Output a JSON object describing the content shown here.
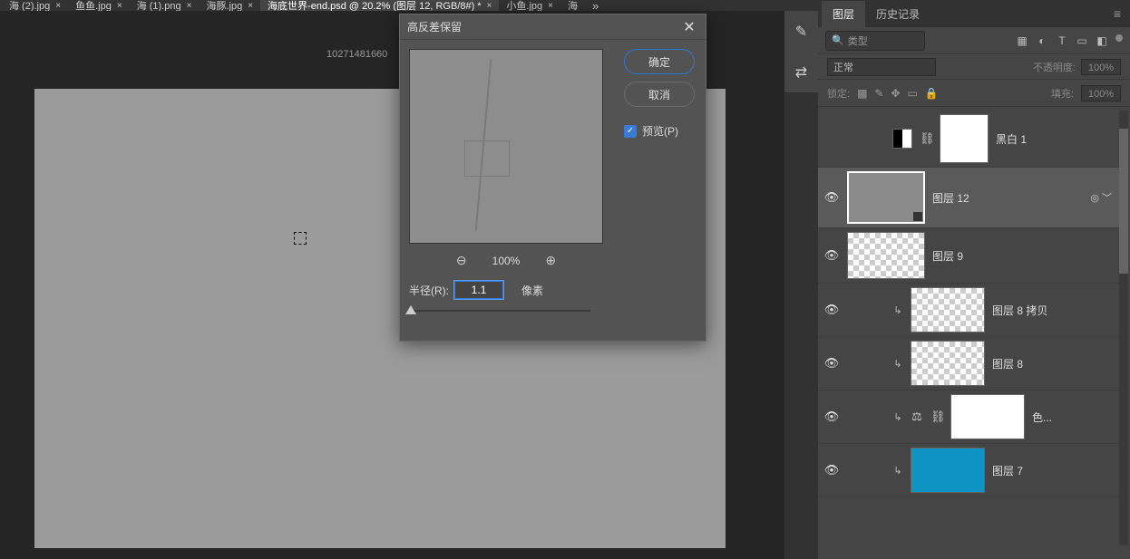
{
  "tabs": [
    {
      "label": "海 (2).jpg"
    },
    {
      "label": "鱼鱼.jpg"
    },
    {
      "label": "海 (1).png"
    },
    {
      "label": "海豚.jpg"
    },
    {
      "label": "海底世界-end.psd @ 20.2% (图层 12, RGB/8#) *"
    },
    {
      "label": "小鱼.jpg"
    },
    {
      "label": "海"
    }
  ],
  "tab_overflow": "»",
  "canvas_info": "10271481660",
  "dialog": {
    "title": "高反差保留",
    "ok": "确定",
    "cancel": "取消",
    "preview_label": "预览(P)",
    "zoom_pct": "100%",
    "radius_label": "半径(R):",
    "radius_value": "1.1",
    "radius_unit": "像素"
  },
  "panel_tabs": {
    "layers": "图层",
    "history": "历史记录"
  },
  "filter_placeholder": "类型",
  "blend_mode": "正常",
  "opacity_label": "不透明度:",
  "opacity_value": "100%",
  "lock_label": "锁定:",
  "fill_label": "填充:",
  "fill_value": "100%",
  "layers": [
    {
      "name": "黑白 1"
    },
    {
      "name": "图层 12"
    },
    {
      "name": "图层 9"
    },
    {
      "name": "图层 8 拷贝"
    },
    {
      "name": "图层 8"
    },
    {
      "name": "色..."
    },
    {
      "name": "图层 7"
    }
  ]
}
